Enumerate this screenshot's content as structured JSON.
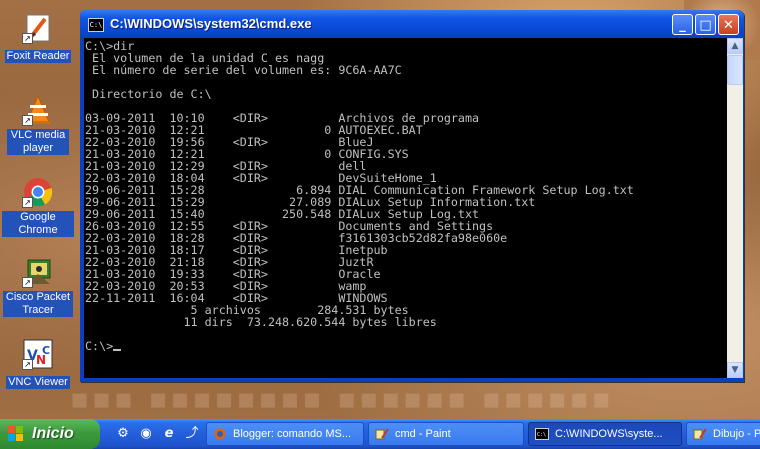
{
  "window": {
    "title": "C:\\WINDOWS\\system32\\cmd.exe",
    "icon_text": "C:\\",
    "controls": {
      "minimize": "_",
      "maximize": "□",
      "close": "✕"
    },
    "scroll_up": "▲",
    "scroll_down": "▼"
  },
  "console": {
    "prompt_line": "C:\\>dir",
    "volume_line": " El volumen de la unidad C es nagg",
    "serial_line": " El número de serie del volumen es: 9C6A-AA7C",
    "blank": "",
    "dir_header": " Directorio de C:\\",
    "entries": [
      "03-09-2011  10:10    <DIR>          Archivos de programa",
      "21-03-2010  12:21                 0 AUTOEXEC.BAT",
      "22-03-2010  19:56    <DIR>          BlueJ",
      "21-03-2010  12:21                 0 CONFIG.SYS",
      "21-03-2010  12:29    <DIR>          dell",
      "22-03-2010  18:04    <DIR>          DevSuiteHome_1",
      "29-06-2011  15:28             6.894 DIAL Communication Framework Setup Log.txt",
      "29-06-2011  15:29            27.089 DIALux Setup Information.txt",
      "29-06-2011  15:40           250.548 DIALux Setup Log.txt",
      "26-03-2010  12:55    <DIR>          Documents and Settings",
      "22-03-2010  18:28    <DIR>          f3161303cb52d82fa98e060e",
      "21-03-2010  18:17    <DIR>          Inetpub",
      "22-03-2010  21:18    <DIR>          JuztR",
      "21-03-2010  19:33    <DIR>          Oracle",
      "22-03-2010  20:53    <DIR>          wamp",
      "22-11-2011  16:04    <DIR>          WINDOWS"
    ],
    "files_summary": "               5 archivos        284.531 bytes",
    "dirs_summary": "              11 dirs  73.248.620.544 bytes libres",
    "final_prompt": "C:\\>"
  },
  "desktop": {
    "icons": [
      {
        "label": "Foxit Reader",
        "icon": "foxit-reader-icon"
      },
      {
        "label": "VLC media player",
        "icon": "vlc-icon"
      },
      {
        "label": "Google Chrome",
        "icon": "chrome-icon"
      },
      {
        "label": "Cisco Packet Tracer",
        "icon": "packet-tracer-icon"
      },
      {
        "label": "VNC Viewer",
        "icon": "vnc-icon"
      }
    ],
    "shortcut_arrow": "↗"
  },
  "taskbar": {
    "start_label": "Inicio",
    "quick_launch": [
      "⚙",
      "◉",
      "e",
      "⤴"
    ],
    "tasks": [
      {
        "label": "Blogger: comando MS...",
        "icon": "firefox-icon"
      },
      {
        "label": "cmd - Paint",
        "icon": "paint-icon"
      },
      {
        "label": "C:\\WINDOWS\\syste...",
        "icon": "cmd-icon"
      },
      {
        "label": "Dibujo - P",
        "icon": "paint-icon"
      }
    ]
  },
  "colors": {
    "console_bg": "#000000",
    "console_fg": "#c0c0c0",
    "titlebar": "#0a48d4",
    "taskbar": "#245edb",
    "start_green": "#3c9a3c",
    "desktop_label_bg": "#2352b8"
  }
}
